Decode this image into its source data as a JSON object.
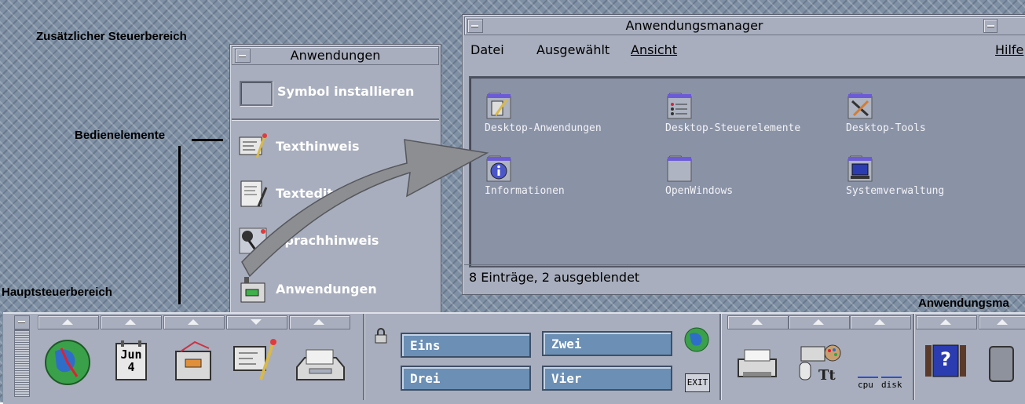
{
  "callouts": {
    "subpanel": "Zusätzlicher Steuerbereich",
    "controls": "Bedienelemente",
    "mainpanel": "Hauptsteuerbereich",
    "appmgr": "Anwendungsma"
  },
  "subpanel": {
    "title": "Anwendungen",
    "install_label": "Symbol installieren",
    "items": [
      {
        "label": "Texthinweis",
        "icon": "text-note-icon"
      },
      {
        "label": "Texteditor",
        "icon": "text-editor-icon"
      },
      {
        "label": "Sprachhinweis",
        "icon": "voice-note-icon"
      },
      {
        "label": "Anwendungen",
        "icon": "applications-icon"
      }
    ]
  },
  "appmgr": {
    "title": "Anwendungsmanager",
    "menu": {
      "file": "Datei",
      "selected": "Ausgewählt",
      "view": "Ansicht",
      "help": "Hilfe"
    },
    "items": [
      {
        "label": "Desktop-Anwendungen",
        "icon": "desktop-apps-icon"
      },
      {
        "label": "Desktop-Steuerelemente",
        "icon": "desktop-controls-icon"
      },
      {
        "label": "Desktop-Tools",
        "icon": "desktop-tools-icon"
      },
      {
        "label": "Informationen",
        "icon": "info-icon"
      },
      {
        "label": "OpenWindows",
        "icon": "folder-icon"
      },
      {
        "label": "Systemverwaltung",
        "icon": "system-admin-icon"
      }
    ],
    "status": "8 Einträge, 2 ausgeblendet"
  },
  "frontpanel": {
    "calendar": {
      "month": "Jun",
      "day": "4"
    },
    "workspaces": [
      "Eins",
      "Zwei",
      "Drei",
      "Vier"
    ],
    "exit_label": "EXIT",
    "monitor": {
      "cpu": "cpu",
      "disk": "disk"
    },
    "help_glyph": "?"
  },
  "colors": {
    "desktop": "#7f90a4",
    "panel": "#a8aebd",
    "workspace_button": "#6b8fb5",
    "arrow": "#8c8e92"
  }
}
